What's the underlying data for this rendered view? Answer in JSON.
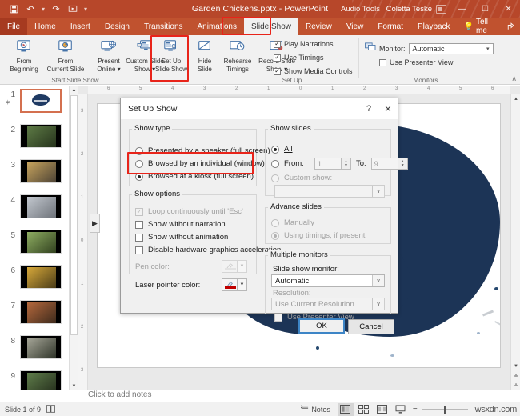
{
  "titlebar": {
    "quick_access": [
      "save-icon",
      "undo-icon",
      "redo-icon",
      "start-show-icon",
      "customize-icon"
    ],
    "document_title": "Garden Chickens.pptx  -  PowerPoint",
    "contextual_tab_group": "Audio Tools",
    "account_name": "Coletta Teske",
    "minimize": "—",
    "maximize": "☐",
    "close": "✕"
  },
  "tabs": [
    {
      "label": "File",
      "active": false
    },
    {
      "label": "Home",
      "active": false
    },
    {
      "label": "Insert",
      "active": false
    },
    {
      "label": "Design",
      "active": false
    },
    {
      "label": "Transitions",
      "active": false
    },
    {
      "label": "Animations",
      "active": false
    },
    {
      "label": "Slide Show",
      "active": true
    },
    {
      "label": "Review",
      "active": false
    },
    {
      "label": "View",
      "active": false
    },
    {
      "label": "Format",
      "active": false
    },
    {
      "label": "Playback",
      "active": false
    }
  ],
  "tellme": {
    "label": "Tell me",
    "icon": "lightbulb-icon"
  },
  "tab_right_icons": [
    "share-icon",
    "history-icon",
    "comments-icon"
  ],
  "ribbon": {
    "groups": [
      {
        "label": "Start Slide Show"
      },
      {
        "label": "Set Up"
      },
      {
        "label": "Monitors"
      }
    ],
    "buttons": [
      {
        "line1": "From",
        "line2": "Beginning",
        "icon": "from-beginning-icon"
      },
      {
        "line1": "From",
        "line2": "Current Slide",
        "icon": "from-current-slide-icon"
      },
      {
        "line1": "Present",
        "line2": "Online ▾",
        "icon": "present-online-icon"
      },
      {
        "line1": "Custom Slide",
        "line2": "Show ▾",
        "icon": "custom-slide-show-icon"
      },
      {
        "line1": "Set Up",
        "line2": "Slide Show",
        "icon": "set-up-slide-show-icon",
        "highlighted": true
      },
      {
        "line1": "Hide",
        "line2": "Slide",
        "icon": "hide-slide-icon"
      },
      {
        "line1": "Rehearse",
        "line2": "Timings",
        "icon": "rehearse-timings-icon"
      },
      {
        "line1": "Record Slide",
        "line2": "Show ▾",
        "icon": "record-slide-show-icon"
      }
    ],
    "checkboxes": [
      {
        "label": "Play Narrations",
        "checked": true
      },
      {
        "label": "Use Timings",
        "checked": true
      },
      {
        "label": "Show Media Controls",
        "checked": true
      }
    ],
    "monitor_label": "Monitor:",
    "monitor_value": "Automatic",
    "use_presenter_view": {
      "label": "Use Presenter View",
      "checked": false
    },
    "collapse": "∧"
  },
  "thumbnails": [
    {
      "number": "1",
      "selected": true,
      "starred": true,
      "kind": "title"
    },
    {
      "number": "2",
      "selected": false,
      "kind": "photo",
      "c1": "#5d7a45",
      "c2": "#26331c"
    },
    {
      "number": "3",
      "selected": false,
      "kind": "photo",
      "c1": "#c9a55e",
      "c2": "#4d4335"
    },
    {
      "number": "4",
      "selected": false,
      "kind": "photo",
      "c1": "#c3c8cf",
      "c2": "#6e737a"
    },
    {
      "number": "5",
      "selected": false,
      "kind": "photo",
      "c1": "#8fae62",
      "c2": "#31411f"
    },
    {
      "number": "6",
      "selected": false,
      "kind": "photo",
      "c1": "#d8a93a",
      "c2": "#4a3c18"
    },
    {
      "number": "7",
      "selected": false,
      "kind": "photo",
      "c1": "#b5683c",
      "c2": "#3d2a1c"
    },
    {
      "number": "8",
      "selected": false,
      "kind": "photo",
      "c1": "#a8a89a",
      "c2": "#2e3328"
    },
    {
      "number": "9",
      "selected": false,
      "kind": "photo",
      "c1": "#5f7d4a",
      "c2": "#242d1c"
    }
  ],
  "ruler": {
    "horizontal": [
      "6",
      "5",
      "4",
      "3",
      "2",
      "1",
      "0",
      "1",
      "2",
      "3",
      "4",
      "5",
      "6"
    ],
    "vertical": [
      "3",
      "2",
      "1",
      "0",
      "1",
      "2",
      "3"
    ]
  },
  "outline_toggle_icon": "play-triangle-icon",
  "notes": {
    "placeholder": "Click to add notes"
  },
  "statusbar": {
    "slide_counter": "Slide 1 of 9",
    "accessibility_icon": "notes-page-icon",
    "notes_label": "Notes",
    "view_buttons": [
      "normal-view-icon",
      "slide-sorter-icon",
      "reading-view-icon",
      "slide-show-icon"
    ],
    "zoom_minus": "−",
    "zoom_plus": "+",
    "watermark": "wsxdn.com"
  },
  "dialog": {
    "title": "Set Up Show",
    "help_icon": "?",
    "close_icon": "✕",
    "show_type": {
      "legend": "Show type",
      "options": [
        {
          "label": "Presented by a speaker (full screen)",
          "selected": false,
          "accel": ""
        },
        {
          "label": "Browsed by an individual (window)",
          "selected": false,
          "accel": "B"
        },
        {
          "label": "Browsed at a kiosk (full screen)",
          "selected": true,
          "accel": "k"
        }
      ],
      "highlighted": true
    },
    "show_options": {
      "legend": "Show options",
      "checkboxes": [
        {
          "label": "Loop continuously until 'Esc'",
          "checked": true,
          "disabled": true
        },
        {
          "label": "Show without narration",
          "checked": false,
          "disabled": false
        },
        {
          "label": "Show without animation",
          "checked": false,
          "disabled": false
        },
        {
          "label": "Disable hardware graphics acceleration",
          "checked": false,
          "disabled": false
        }
      ],
      "pen_color_label": "Pen color:",
      "pen_color_disabled": true,
      "laser_color_label": "Laser pointer color:",
      "laser_color_hex": "#c00000"
    },
    "show_slides": {
      "legend": "Show slides",
      "all_label": "All",
      "all_selected": true,
      "from_label": "From:",
      "from_value": "1",
      "to_label": "To:",
      "to_value": "9",
      "custom_show_label": "Custom show:",
      "custom_show_value": "",
      "custom_show_disabled": true
    },
    "advance_slides": {
      "legend": "Advance slides",
      "manually_label": "Manually",
      "manually_selected": false,
      "timings_label": "Using timings, if present",
      "timings_selected": true,
      "disabled": true
    },
    "multiple_monitors": {
      "legend": "Multiple monitors",
      "monitor_label": "Slide show monitor:",
      "monitor_value": "Automatic",
      "resolution_label": "Resolution:",
      "resolution_value": "Use Current Resolution",
      "resolution_disabled": true,
      "presenter_view_label": "Use Presenter View",
      "presenter_view_checked": false,
      "presenter_view_disabled": true
    },
    "ok_label": "OK",
    "cancel_label": "Cancel"
  },
  "colors": {
    "titlebar": "#b7472a",
    "tabstrip": "#c0522f",
    "highlight": "#e8241a",
    "accent_blue": "#3d85c6",
    "ink": "#1c3456"
  }
}
